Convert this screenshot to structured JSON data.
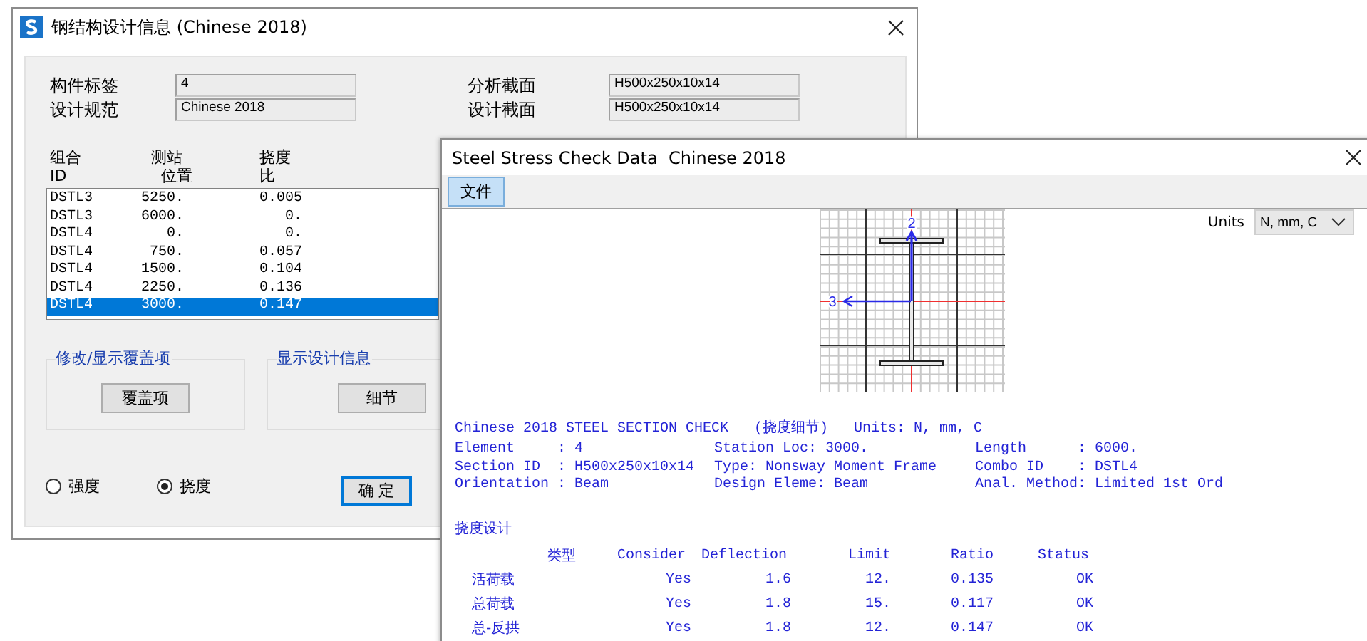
{
  "design_window": {
    "title": "钢结构设计信息 (Chinese 2018)",
    "fields_left": [
      {
        "label": "构件标签",
        "value": "4"
      },
      {
        "label": "设计规范",
        "value": "Chinese 2018"
      }
    ],
    "fields_right": [
      {
        "label": "分析截面",
        "value": "H500x250x10x14"
      },
      {
        "label": "设计截面",
        "value": "H500x250x10x14"
      }
    ],
    "list": {
      "columns": [
        {
          "line1": "组合",
          "line2": "ID"
        },
        {
          "line1": "测站",
          "line2": "位置"
        },
        {
          "line1": "挠度",
          "line2": "比"
        }
      ],
      "rows": [
        {
          "combo": "DSTL3",
          "station": "5250.",
          "ratio": "0.005",
          "selected": false
        },
        {
          "combo": "DSTL3",
          "station": "6000.",
          "ratio": "0.",
          "selected": false
        },
        {
          "combo": "DSTL4",
          "station": "0.",
          "ratio": "0.",
          "selected": false
        },
        {
          "combo": "DSTL4",
          "station": "750.",
          "ratio": "0.057",
          "selected": false
        },
        {
          "combo": "DSTL4",
          "station": "1500.",
          "ratio": "0.104",
          "selected": false
        },
        {
          "combo": "DSTL4",
          "station": "2250.",
          "ratio": "0.136",
          "selected": false
        },
        {
          "combo": "DSTL4",
          "station": "3000.",
          "ratio": "0.147",
          "selected": true
        }
      ]
    },
    "groups": [
      {
        "title": "修改/显示覆盖项",
        "button": "覆盖项"
      },
      {
        "title": "显示设计信息",
        "button": "细节"
      }
    ],
    "radios": [
      {
        "label": "强度",
        "selected": false
      },
      {
        "label": "挠度",
        "selected": true
      }
    ],
    "ok_button": "确 定"
  },
  "check_window": {
    "title": "Steel Stress Check Data  Chinese 2018",
    "menu": [
      {
        "label": "文件",
        "selected": true
      }
    ],
    "units": {
      "label": "Units",
      "value": "N, mm, C"
    },
    "axis_labels": [
      "2",
      "3"
    ],
    "report": {
      "heading": "Chinese 2018 STEEL SECTION CHECK   (挠度细节)   Units: N, mm, C",
      "info": [
        [
          "Element     : 4",
          "Station Loc: 3000.",
          "Length      : 6000."
        ],
        [
          "Section ID  : H500x250x10x14",
          "Type: Nonsway Moment Frame",
          "Combo ID    : DSTL4"
        ],
        [
          "Orientation : Beam",
          "Design Eleme: Beam",
          "Anal. Method: Limited 1st Ord"
        ]
      ],
      "section_title": "挠度设计",
      "columns": [
        "类型",
        "Consider",
        "Deflection",
        "Limit",
        "Ratio",
        "Status"
      ],
      "rows": [
        [
          "活荷载",
          "Yes",
          "1.6",
          "12.",
          "0.135",
          "OK"
        ],
        [
          "总荷载",
          "Yes",
          "1.8",
          "15.",
          "0.117",
          "OK"
        ],
        [
          "总-反拱",
          "Yes",
          "1.8",
          "12.",
          "0.147",
          "OK"
        ]
      ]
    }
  }
}
